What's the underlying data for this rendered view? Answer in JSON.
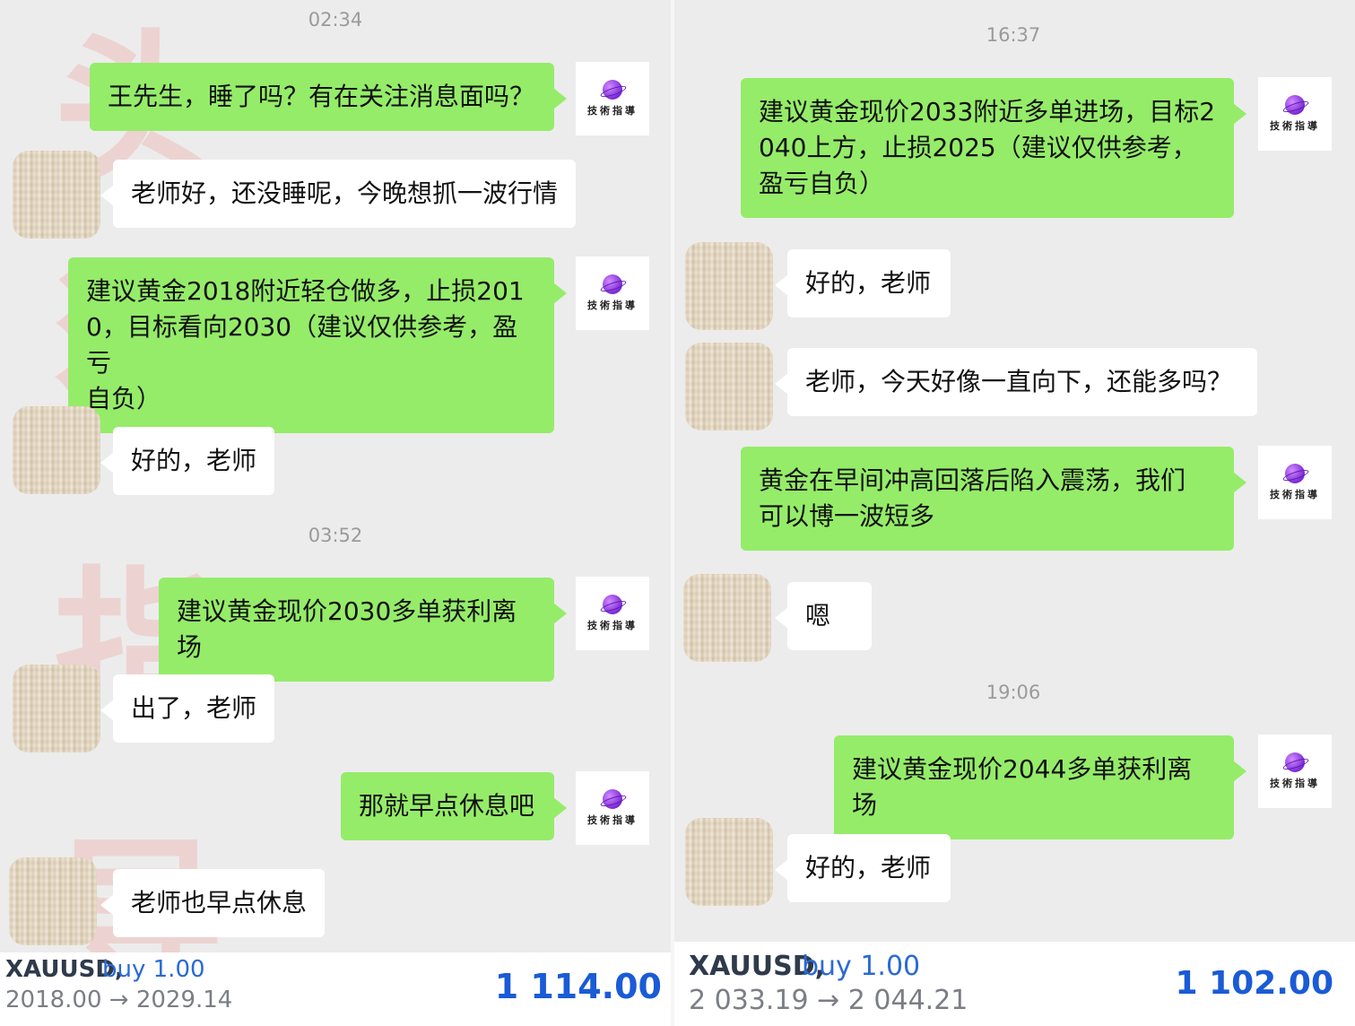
{
  "left": {
    "timestamps": [
      "02:34",
      "03:52"
    ],
    "messages": [
      {
        "from": "teacher",
        "text": "王先生，睡了吗？有在关注消息面吗？"
      },
      {
        "from": "user",
        "text": "老师好，还没睡呢，今晚想抓一波行情"
      },
      {
        "from": "teacher",
        "text": "建议黄金2018附近轻仓做多，止损201\n0，目标看向2030（建议仅供参考，盈亏\n自负）"
      },
      {
        "from": "user",
        "text": "好的，老师"
      },
      {
        "from": "teacher",
        "text": "建议黄金现价2030多单获利离场"
      },
      {
        "from": "user",
        "text": "出了，老师"
      },
      {
        "from": "teacher",
        "text": "那就早点休息吧"
      },
      {
        "from": "user",
        "text": "老师也早点休息"
      }
    ],
    "trade": {
      "symbol": "XAUUSD,",
      "side": "buy 1.00",
      "prices": "2018.00 → 2029.14",
      "profit": "1 114.00"
    }
  },
  "right": {
    "timestamps": [
      "16:37",
      "19:06"
    ],
    "messages": [
      {
        "from": "teacher",
        "text": "建议黄金现价2033附近多单进场，目标2\n040上方，止损2025（建议仅供参考，\n盈亏自负）"
      },
      {
        "from": "user",
        "text": "好的，老师"
      },
      {
        "from": "user",
        "text": "老师，今天好像一直向下，还能多吗？"
      },
      {
        "from": "teacher",
        "text": "黄金在早间冲高回落后陷入震荡，我们\n可以博一波短多"
      },
      {
        "from": "user",
        "text": "嗯"
      },
      {
        "from": "teacher",
        "text": "建议黄金现价2044多单获利离场"
      },
      {
        "from": "user",
        "text": "好的，老师"
      }
    ],
    "trade": {
      "symbol": "XAUUSD,",
      "side": "buy 1.00",
      "prices": "2 033.19 → 2 044.21",
      "profit": "1 102.00"
    }
  },
  "avatar": {
    "teacher_text": "技術指導",
    "teacher_icon": "planet-logo-icon",
    "user_icon": "knit-texture-avatar"
  },
  "watermark": [
    "头",
    "狼",
    "指",
    "导"
  ],
  "colors": {
    "outgoing_bubble": "#95ec69",
    "incoming_bubble": "#ffffff",
    "chat_bg": "#ececec",
    "profit": "#1a5bd6",
    "buy": "#2a6ad4"
  }
}
